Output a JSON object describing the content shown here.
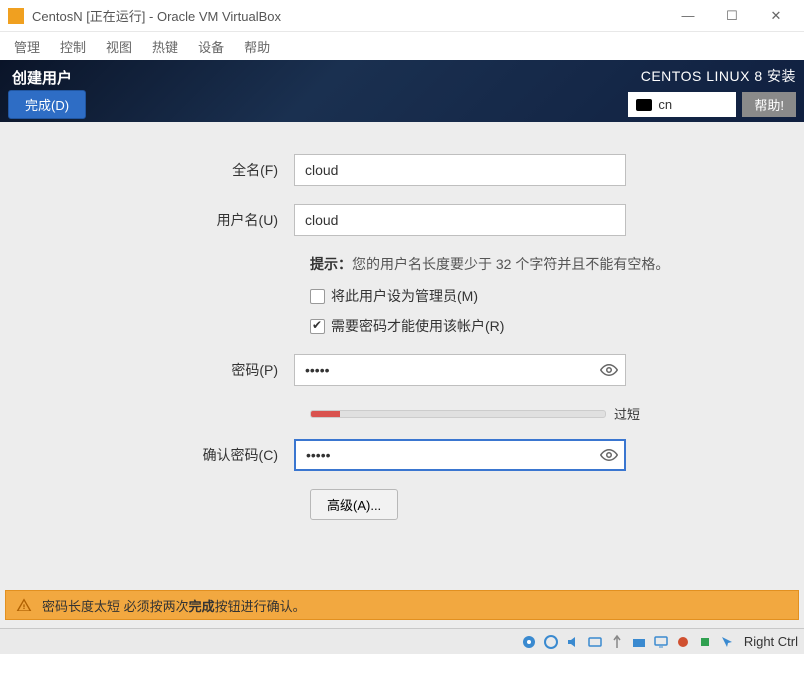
{
  "vbox": {
    "title": "CentosN [正在运行] - Oracle VM VirtualBox",
    "menu": [
      "管理",
      "控制",
      "视图",
      "热键",
      "设备",
      "帮助"
    ],
    "win": {
      "min": "—",
      "max": "☐",
      "close": "✕"
    },
    "status_host_key": "Right Ctrl"
  },
  "header": {
    "title": "创建用户",
    "done": "完成(D)",
    "product": "CENTOS LINUX 8 安装",
    "keyboard": "cn",
    "help": "帮助!"
  },
  "form": {
    "fullname_label": "全名(F)",
    "fullname_value": "cloud",
    "username_label": "用户名(U)",
    "username_value": "cloud",
    "hint_prefix": "提示：",
    "hint_text": "您的用户名长度要少于 32 个字符并且不能有空格。",
    "admin_check": "将此用户设为管理员(M)",
    "admin_checked": false,
    "pwreq_check": "需要密码才能使用该帐户(R)",
    "pwreq_checked": true,
    "password_label": "密码(P)",
    "password_value": "•••••",
    "confirm_label": "确认密码(C)",
    "confirm_value": "•••••",
    "strength_label": "过短",
    "advanced": "高级(A)..."
  },
  "warning": {
    "text_pre": "密码长度太短 必须按两次",
    "text_bold": "完成",
    "text_post": "按钮进行确认。"
  }
}
